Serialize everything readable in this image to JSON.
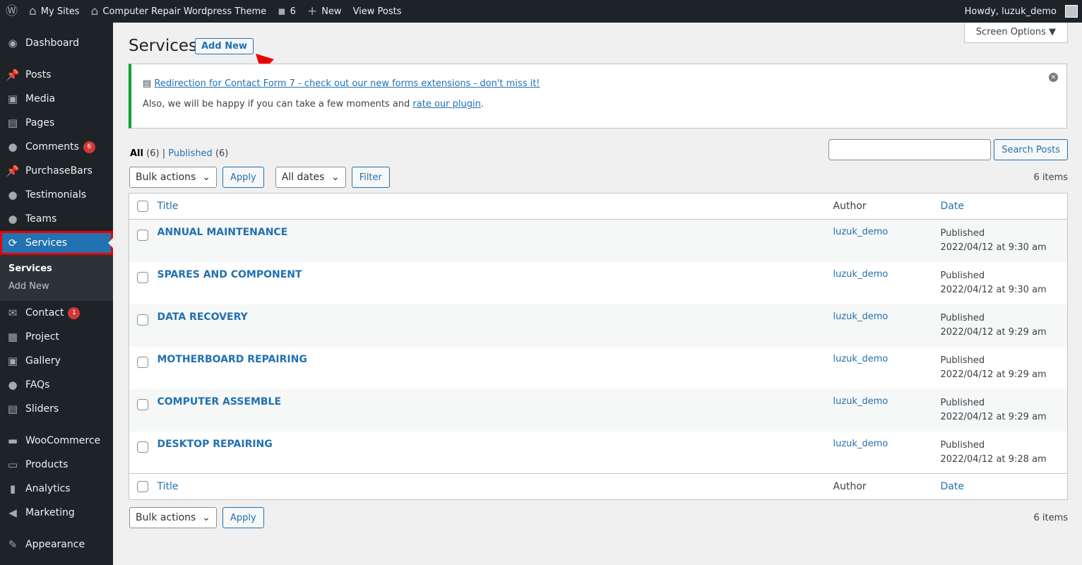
{
  "adminbar": {
    "sites": "My Sites",
    "site_name": "Computer Repair Wordpress Theme",
    "comments": "6",
    "new": "New",
    "view": "View Posts",
    "howdy": "Howdy, luzuk_demo"
  },
  "sidebar": {
    "items": [
      {
        "label": "Dashboard",
        "icon": "dashboard-icon",
        "glyph": "◉"
      },
      {
        "label": "Posts",
        "icon": "pin-icon",
        "glyph": "📌",
        "sep": true
      },
      {
        "label": "Media",
        "icon": "media-icon",
        "glyph": "▣"
      },
      {
        "label": "Pages",
        "icon": "pages-icon",
        "glyph": "▤"
      },
      {
        "label": "Comments",
        "icon": "comment-icon",
        "glyph": "●",
        "badge": "6"
      },
      {
        "label": "PurchaseBars",
        "icon": "pin-icon",
        "glyph": "📌"
      },
      {
        "label": "Testimonials",
        "icon": "testimonial-icon",
        "glyph": "●"
      },
      {
        "label": "Teams",
        "icon": "teams-icon",
        "glyph": "●"
      },
      {
        "label": "Services",
        "icon": "update-icon",
        "glyph": "⟳",
        "current": true
      }
    ],
    "submenu": [
      "Services",
      "Add New"
    ],
    "items2": [
      {
        "label": "Contact",
        "icon": "mail-icon",
        "glyph": "✉",
        "badge": "1"
      },
      {
        "label": "Project",
        "icon": "project-icon",
        "glyph": "▦"
      },
      {
        "label": "Gallery",
        "icon": "gallery-icon",
        "glyph": "▣"
      },
      {
        "label": "FAQs",
        "icon": "faq-icon",
        "glyph": "●"
      },
      {
        "label": "Sliders",
        "icon": "slider-icon",
        "glyph": "▤"
      },
      {
        "label": "WooCommerce",
        "icon": "woo-icon",
        "glyph": "▬",
        "sep": true
      },
      {
        "label": "Products",
        "icon": "products-icon",
        "glyph": "▭"
      },
      {
        "label": "Analytics",
        "icon": "analytics-icon",
        "glyph": "▮"
      },
      {
        "label": "Marketing",
        "icon": "megaphone-icon",
        "glyph": "◀"
      },
      {
        "label": "Appearance",
        "icon": "brush-icon",
        "glyph": "✎",
        "sep": true
      }
    ]
  },
  "screen_options": "Screen Options ▼",
  "page": {
    "title": "Services",
    "add_new": "Add New"
  },
  "notice": {
    "link": "Redirection for Contact Form 7 - check out our new forms extensions - don't miss it!",
    "text": "Also, we will be happy if you can take a few moments and ",
    "rate": "rate our plugin",
    "end": "."
  },
  "filters": {
    "all": "All",
    "all_count": "(6)",
    "sep": "|",
    "published": "Published",
    "pub_count": "(6)"
  },
  "search": {
    "button": "Search Posts"
  },
  "tablenav": {
    "bulk": "Bulk actions",
    "apply": "Apply",
    "dates": "All dates",
    "filter": "Filter",
    "count": "6 items"
  },
  "table": {
    "headers": {
      "title": "Title",
      "author": "Author",
      "date": "Date"
    },
    "rows": [
      {
        "title": "ANNUAL MAINTENANCE",
        "author": "luzuk_demo",
        "status": "Published",
        "date": "2022/04/12 at 9:30 am"
      },
      {
        "title": "SPARES AND COMPONENT",
        "author": "luzuk_demo",
        "status": "Published",
        "date": "2022/04/12 at 9:30 am"
      },
      {
        "title": "DATA RECOVERY",
        "author": "luzuk_demo",
        "status": "Published",
        "date": "2022/04/12 at 9:29 am"
      },
      {
        "title": "MOTHERBOARD REPAIRING",
        "author": "luzuk_demo",
        "status": "Published",
        "date": "2022/04/12 at 9:29 am"
      },
      {
        "title": "COMPUTER ASSEMBLE",
        "author": "luzuk_demo",
        "status": "Published",
        "date": "2022/04/12 at 9:29 am"
      },
      {
        "title": "DESKTOP REPAIRING",
        "author": "luzuk_demo",
        "status": "Published",
        "date": "2022/04/12 at 9:28 am"
      }
    ]
  }
}
